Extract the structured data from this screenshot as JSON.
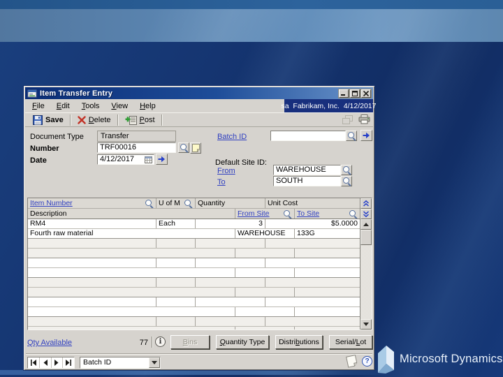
{
  "slide": {
    "logo_text": "Microsoft Dynamics",
    "logo_tm": "™"
  },
  "window": {
    "title": "Item Transfer Entry",
    "menu_items": [
      "_File",
      "_Edit",
      "_Tools",
      "_View",
      "_Help"
    ],
    "status_text": "sa  Fabrikam, Inc.  4/12/2017",
    "toolbar": {
      "save": "Save",
      "delete": "_Delete",
      "post": "_Post"
    },
    "form": {
      "document_type_label": "Document Type",
      "document_type_value": "Transfer",
      "number_label": "Number",
      "number_value": "TRF00016",
      "date_label": "Date",
      "date_value": "4/12/2017",
      "batch_id_label": "Batch ID",
      "batch_id_value": "",
      "default_site_label": "Default Site ID:",
      "from_label": "From",
      "from_value": "WAREHOUSE",
      "to_label": "To",
      "to_value": "SOUTH"
    },
    "grid": {
      "headers": {
        "item_number": "Item Number",
        "uofm": "U of M",
        "quantity": "Quantity",
        "unit_cost": "Unit Cost",
        "description": "Description",
        "from_site": "From Site",
        "to_site": "To Site"
      },
      "rows": [
        {
          "item_number": "RM4",
          "uofm": "Each",
          "quantity": "3",
          "unit_cost": "$5.0000",
          "description": "Fourth raw material",
          "from_site": "WAREHOUSE",
          "to_site": "133G"
        }
      ]
    },
    "footer": {
      "qty_available_label": "Qty Available",
      "qty_available_value": "77",
      "buttons": {
        "bins": "_Bins",
        "quantity_type": "_Quantity Type",
        "distributions": "Distri_butions",
        "serial_lot": "Serial/_Lot"
      }
    },
    "bottom": {
      "combo_value": "Batch ID"
    }
  }
}
